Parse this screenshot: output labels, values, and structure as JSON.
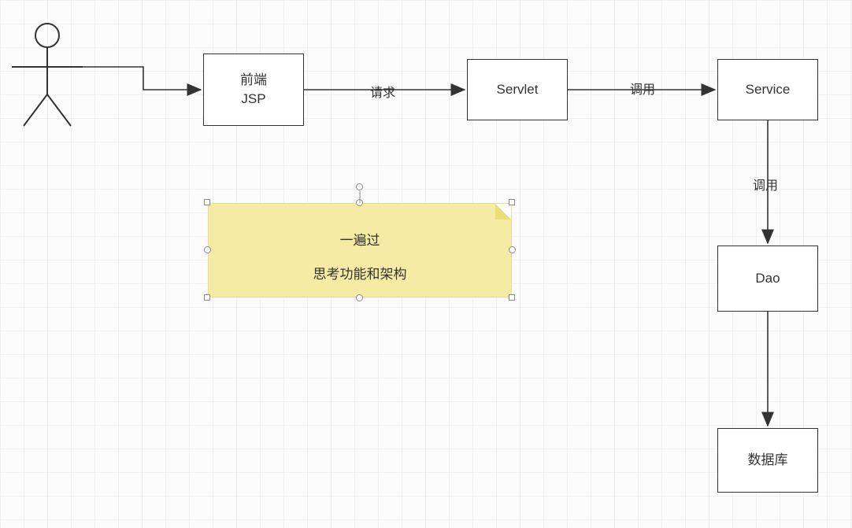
{
  "actor": {
    "label": "actor"
  },
  "boxes": {
    "frontend": {
      "line1": "前端",
      "line2": "JSP"
    },
    "servlet": "Servlet",
    "service": "Service",
    "dao": "Dao",
    "database": "数据库"
  },
  "arrows": {
    "actor_to_frontend": "",
    "frontend_to_servlet": "请求",
    "servlet_to_service": "调用",
    "service_to_dao": "调用",
    "dao_to_database": ""
  },
  "note": {
    "line1": "一遍过",
    "line2": "思考功能和架构"
  }
}
